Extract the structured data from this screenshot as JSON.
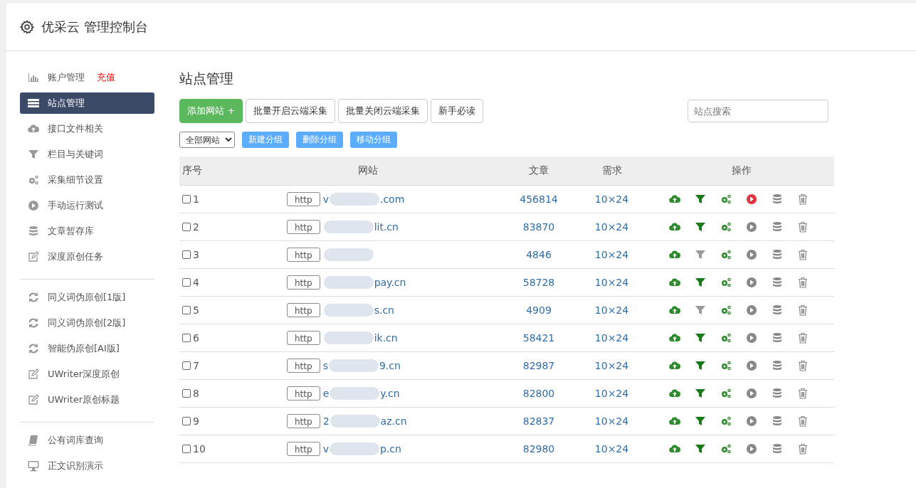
{
  "header": {
    "title": "优采云 管理控制台"
  },
  "sidebar": {
    "groups": [
      {
        "items": [
          {
            "label": "账户管理",
            "badge": "充值",
            "kind": "chart",
            "selected": false
          },
          {
            "label": "站点管理",
            "kind": "server",
            "selected": true
          },
          {
            "label": "接口文件相关",
            "kind": "cloud",
            "selected": false
          },
          {
            "label": "栏目与关键词",
            "kind": "filter",
            "selected": false
          },
          {
            "label": "采集细节设置",
            "kind": "gears",
            "selected": false
          },
          {
            "label": "手动运行测试",
            "kind": "play",
            "selected": false
          },
          {
            "label": "文章暂存库",
            "kind": "database",
            "selected": false
          },
          {
            "label": "深度原创任务",
            "kind": "edit",
            "selected": false
          }
        ]
      },
      {
        "items": [
          {
            "label": "同义词伪原创[1版]",
            "kind": "refresh",
            "selected": false
          },
          {
            "label": "同义词伪原创[2版]",
            "kind": "refresh",
            "selected": false
          },
          {
            "label": "智能伪原创[AI版]",
            "kind": "refresh",
            "selected": false
          },
          {
            "label": "UWriter深度原创",
            "kind": "edit",
            "selected": false
          },
          {
            "label": "UWriter原创标题",
            "kind": "edit",
            "selected": false
          }
        ]
      },
      {
        "items": [
          {
            "label": "公有词库查询",
            "kind": "book",
            "selected": false
          },
          {
            "label": "正文识别演示",
            "kind": "monitor",
            "selected": false
          }
        ]
      }
    ]
  },
  "main": {
    "title": "站点管理",
    "primary_button": "添加网站 +",
    "buttons": [
      "批量开启云端采集",
      "批量关闭云端采集",
      "新手必读"
    ],
    "search": {
      "placeholder": "站点搜索"
    },
    "group_select": "全部网站",
    "group_buttons": [
      "新建分组",
      "删除分组",
      "移动分组"
    ],
    "table": {
      "columns": [
        "序号",
        "网站",
        "文章",
        "需求",
        "操作"
      ],
      "rows": [
        {
          "checked": false,
          "index": "1",
          "protocol": "http",
          "site_start": "v",
          "site_end": ".com",
          "articles": "456814",
          "demand": "10×24",
          "filter_on": true,
          "running": true
        },
        {
          "checked": false,
          "index": "2",
          "protocol": "http",
          "site_end": "lit.cn",
          "articles": "83870",
          "demand": "10×24",
          "filter_on": true,
          "running": false
        },
        {
          "checked": false,
          "index": "3",
          "protocol": "http",
          "articles": "4846",
          "demand": "10×24",
          "filter_on": false,
          "running": false
        },
        {
          "checked": false,
          "index": "4",
          "protocol": "http",
          "site_end": "pay.cn",
          "articles": "58728",
          "demand": "10×24",
          "filter_on": true,
          "running": false
        },
        {
          "checked": false,
          "index": "5",
          "protocol": "http",
          "site_end": "s.cn",
          "articles": "4909",
          "demand": "10×24",
          "filter_on": false,
          "running": false
        },
        {
          "checked": false,
          "index": "6",
          "protocol": "http",
          "site_end": "ik.cn",
          "articles": "58421",
          "demand": "10×24",
          "filter_on": true,
          "running": false
        },
        {
          "checked": false,
          "index": "7",
          "protocol": "http",
          "site_start": "s",
          "site_end": "9.cn",
          "articles": "82987",
          "demand": "10×24",
          "filter_on": true,
          "running": false
        },
        {
          "checked": false,
          "index": "8",
          "protocol": "http",
          "site_start": "e",
          "site_end": "y.cn",
          "articles": "82800",
          "demand": "10×24",
          "filter_on": true,
          "running": false
        },
        {
          "checked": false,
          "index": "9",
          "protocol": "http",
          "site_start": "2",
          "site_end": "az.cn",
          "articles": "82837",
          "demand": "10×24",
          "filter_on": true,
          "running": false
        },
        {
          "checked": false,
          "index": "10",
          "protocol": "http",
          "site_start": "v",
          "site_end": "p.cn",
          "articles": "82980",
          "demand": "10×24",
          "filter_on": true,
          "running": false
        }
      ]
    }
  }
}
